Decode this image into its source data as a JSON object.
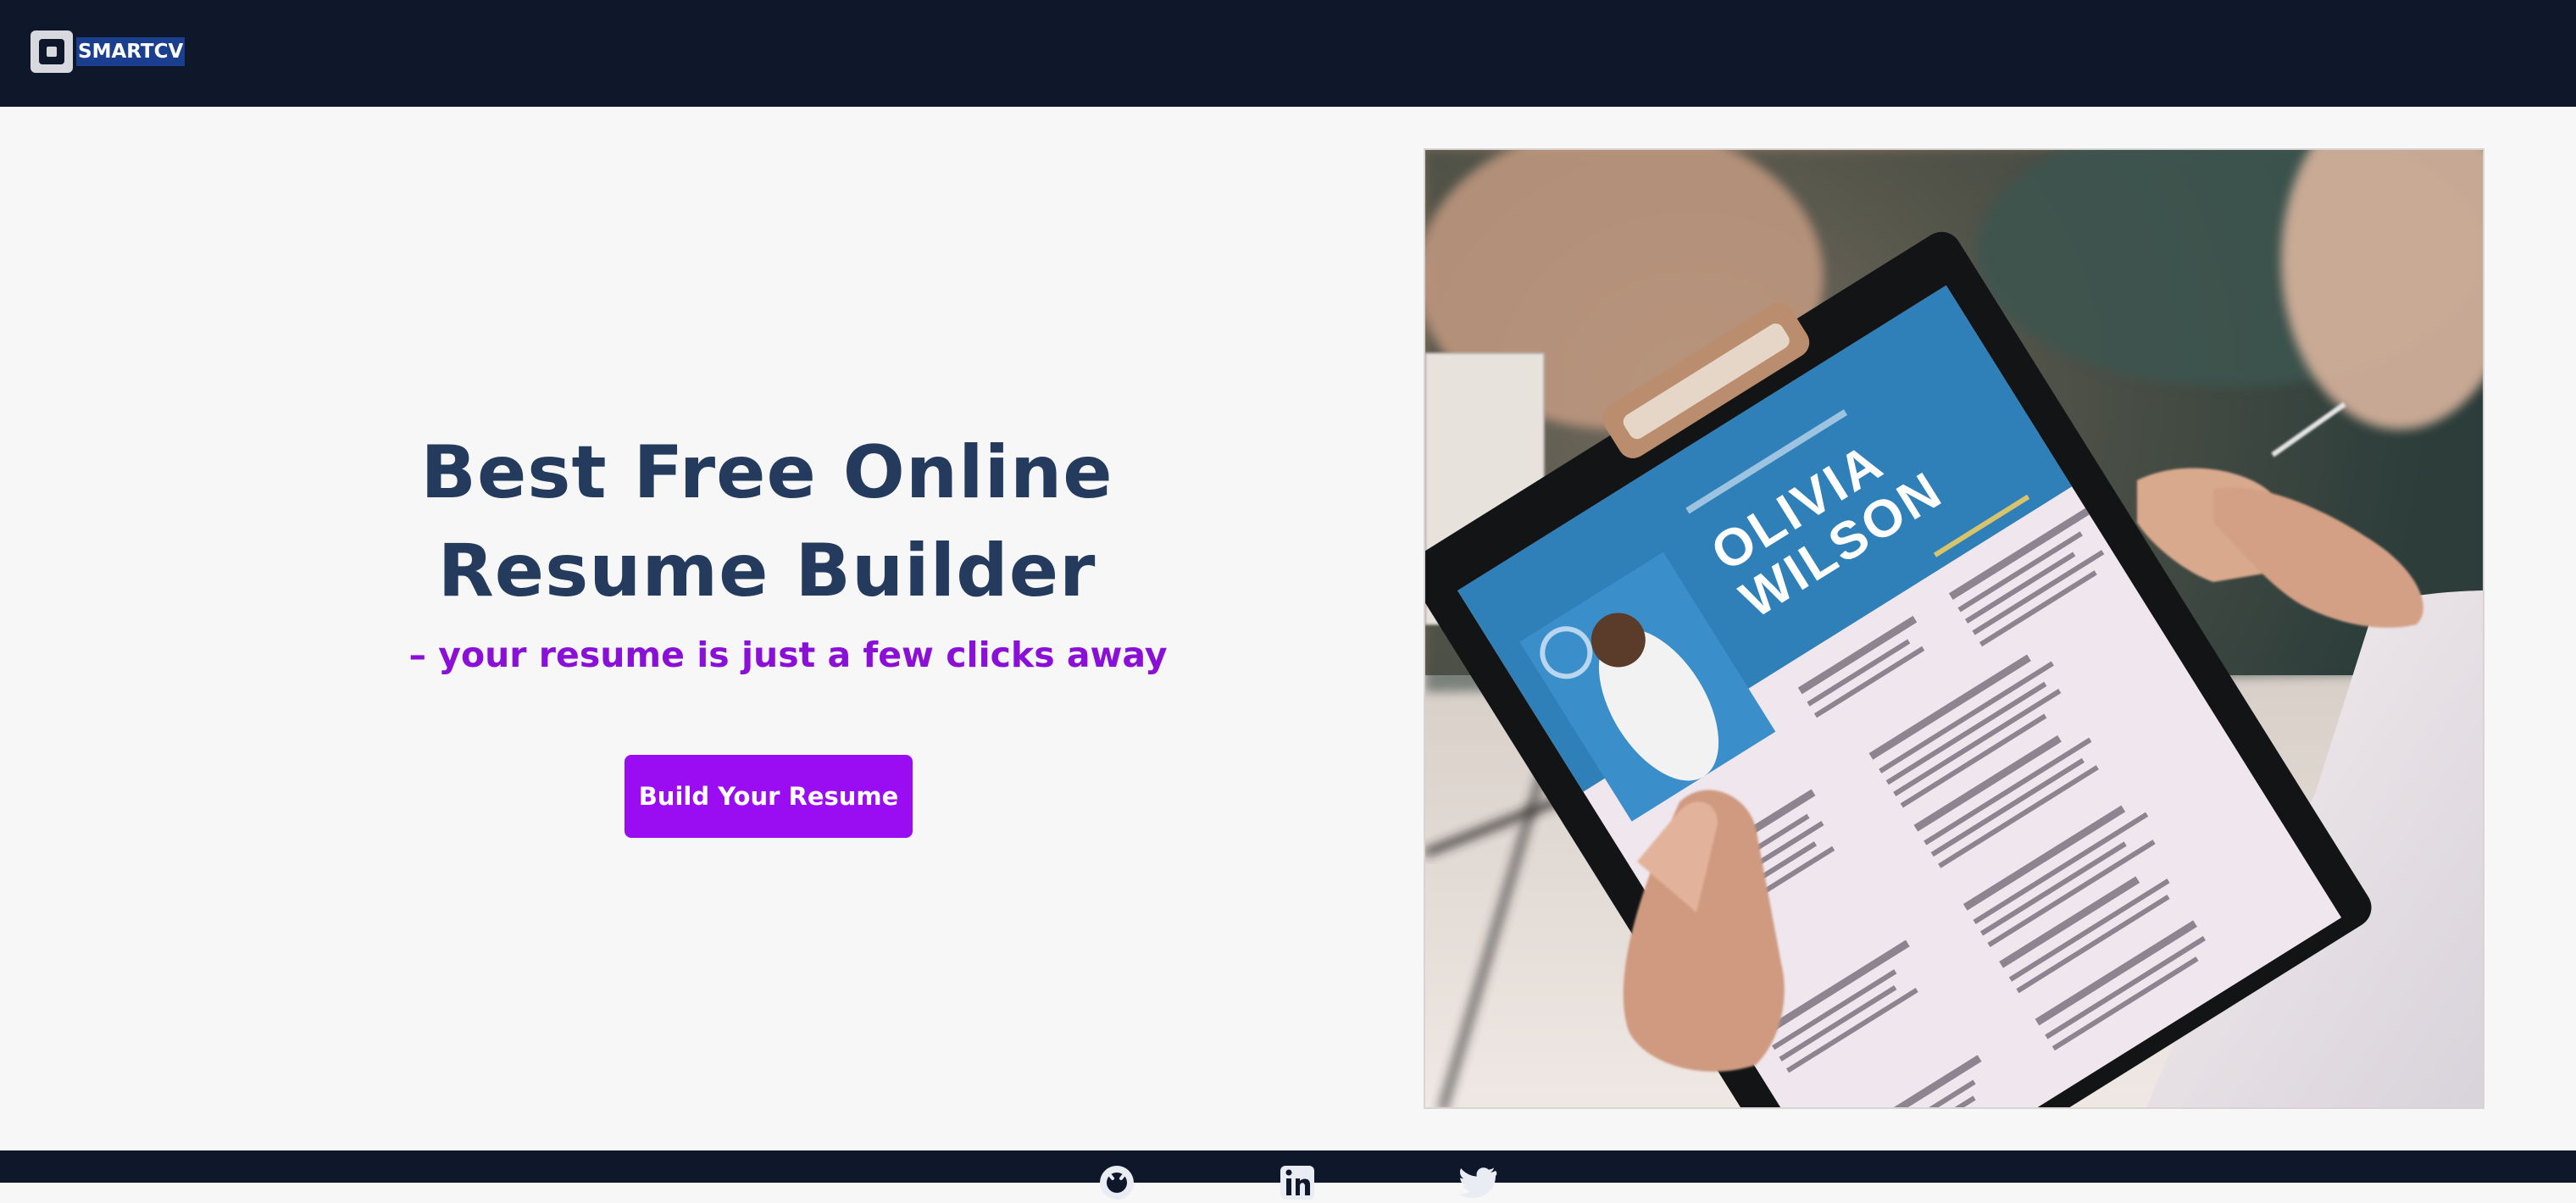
{
  "header": {
    "brand_name": "SMARTCV",
    "logo_icon": "square-logo-icon"
  },
  "hero": {
    "title": "Best Free Online Resume Builder",
    "subtitle": "– your resume is just a few clicks away",
    "cta_label": "Build Your Resume",
    "image": {
      "description_icon": "resume-clipboard-photo",
      "resume_name_line1": "OLIVIA",
      "resume_name_line2": "WILSON"
    }
  },
  "footer": {
    "social_icons": [
      "github-icon",
      "linkedin-icon",
      "twitter-icon"
    ]
  },
  "colors": {
    "header_bg": "#0f172a",
    "page_bg": "#f7f7f7",
    "title": "#243b5e",
    "subtitle": "#8a10d8",
    "button_bg": "#9a0df2",
    "button_text": "#ffffff",
    "brand_highlight": "#1b3f8f"
  }
}
